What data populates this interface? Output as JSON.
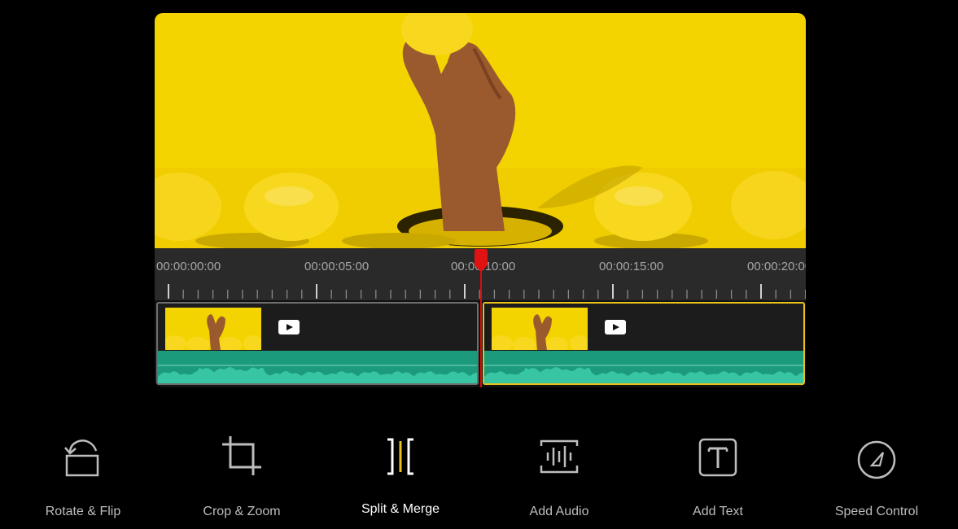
{
  "timeline": {
    "time_labels": [
      "00:00:00:00",
      "00:00:05:00",
      "00:00:10:00",
      "00:00:15:00",
      "00:00:20:00"
    ]
  },
  "clips": [
    {
      "icon": "play-icon",
      "selected": false
    },
    {
      "icon": "play-icon",
      "selected": true
    }
  ],
  "toolbar": {
    "items": [
      {
        "label": "Rotate & Flip",
        "icon": "rotate-flip-icon",
        "active": false
      },
      {
        "label": "Crop & Zoom",
        "icon": "crop-icon",
        "active": false
      },
      {
        "label": "Split & Merge",
        "icon": "split-merge-icon",
        "active": true
      },
      {
        "label": "Add Audio",
        "icon": "audio-icon",
        "active": false
      },
      {
        "label": "Add Text",
        "icon": "text-icon",
        "active": false
      },
      {
        "label": "Speed Control",
        "icon": "speed-icon",
        "active": false
      }
    ]
  },
  "colors": {
    "accent": "#e8c21a",
    "playhead": "#d40f0f",
    "audio_track": "#1b9a7c",
    "preview_background": "#f3d400"
  }
}
